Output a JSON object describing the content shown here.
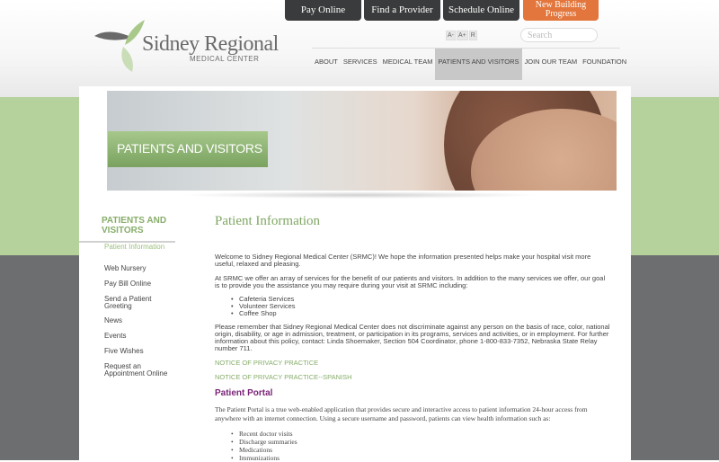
{
  "header": {
    "buttons": [
      "Pay Online",
      "Find a Provider",
      "Schedule Online",
      "New Building Progress"
    ],
    "logo_name": "Sidney Regional",
    "logo_sub": "MEDICAL CENTER",
    "text_size": [
      "A-",
      "A+",
      "R"
    ],
    "search_placeholder": "Search"
  },
  "nav": [
    "ABOUT",
    "SERVICES",
    "MEDICAL TEAM",
    "PATIENTS AND VISITORS",
    "JOIN OUR TEAM",
    "FOUNDATION"
  ],
  "hero_label": "PATIENTS AND VISITORS",
  "sidebar": {
    "title": "PATIENTS AND VISITORS",
    "items": [
      "Patient Information",
      "Web Nursery",
      "Pay Bill Online",
      "Send a Patient Greeting",
      "News",
      "Events",
      "Five Wishes",
      "Request an Appointment Online"
    ]
  },
  "main": {
    "title": "Patient Information",
    "p1": "Welcome to Sidney Regional Medical Center (SRMC)! We hope the information presented helps make your hospital visit more useful, relaxed and pleasing.",
    "p2": "At SRMC we offer an array of services for the benefit of our patients and visitors. In addition to the many services we offer, our goal is to provide you the assistance you may require during your visit at SRMC including:",
    "services": [
      "Cafeteria Services",
      "Volunteer Services",
      "Coffee Shop"
    ],
    "p3": "Please remember that Sidney Regional Medical Center does not discriminate against any person on the basis of race, color, national origin, disability, or age in admission, treatment, or participation in its programs, services and activities, or in employment. For further information about this policy, contact: Linda Shoemaker, Section 504 Coordinator, phone 1-800-833-7352, Nebraska State Relay number 711.",
    "link1": "NOTICE OF PRIVACY PRACTICE",
    "link2": "NOTICE OF PRIVACY PRACTICE--SPANISH",
    "portal_title": "Patient Portal",
    "portal_text": "The Patient Portal is a true web-enabled application that provides secure and interactive access to patient information 24-hour access from anywhere with an internet connection. Using a secure username and password, patients can view health information such as:",
    "portal_items": [
      "Recent doctor visits",
      "Discharge summaries",
      "Medications",
      "Immunizations"
    ]
  },
  "colors": {
    "green": "#b5d19c",
    "accent": "#86ad69",
    "orange": "#e3763c",
    "purple": "#7a2578"
  }
}
